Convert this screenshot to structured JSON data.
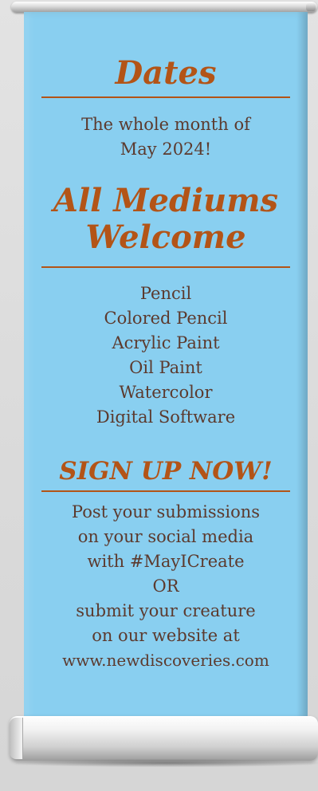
{
  "banner": {
    "dates_heading": "Dates",
    "dates_text": [
      "The whole month of",
      "May 2024!"
    ],
    "mediums_heading": [
      "All Mediums",
      "Welcome"
    ],
    "mediums": [
      "Pencil",
      "Colored Pencil",
      "Acrylic Paint",
      "Oil Paint",
      "Watercolor",
      "Digital Software"
    ],
    "signup_heading": "SIGN UP NOW!",
    "signup_text": [
      "Post your submissions",
      "on your social media",
      "with #MayICreate",
      "OR",
      "submit your creature",
      "on our website at",
      "www.newdiscoveries.com"
    ]
  },
  "colors": {
    "banner_background": "#89cff0",
    "heading": "#b35417",
    "body_text": "#5c3a2e"
  }
}
